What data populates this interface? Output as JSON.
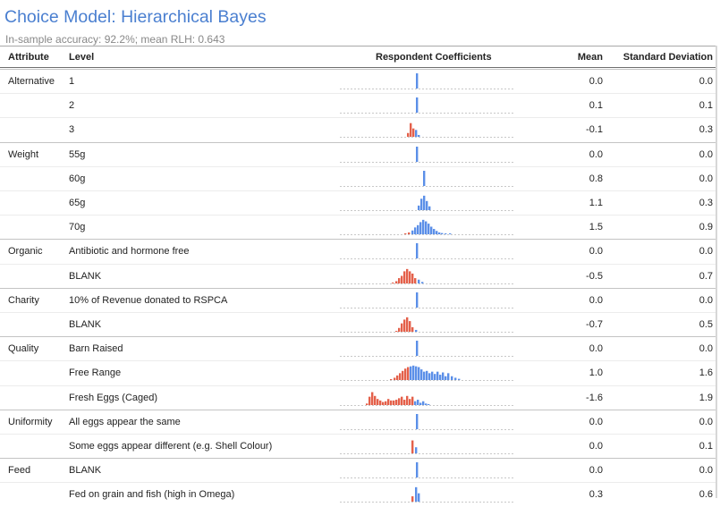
{
  "title": "Choice Model: Hierarchical Bayes",
  "subtitle": "In-sample accuracy: 92.2%; mean RLH: 0.643",
  "columns": {
    "attribute": "Attribute",
    "level": "Level",
    "coefficients": "Respondent Coefficients",
    "mean": "Mean",
    "sd": "Standard Deviation"
  },
  "colors": {
    "positive": "#5b8fe8",
    "negative": "#e4604a",
    "title": "#4a7fd0"
  },
  "chart_data": {
    "type": "table",
    "rows": [
      {
        "attribute": "Alternative",
        "level": "1",
        "mean": "0.0",
        "sd": "0.0"
      },
      {
        "attribute": "",
        "level": "2",
        "mean": "0.1",
        "sd": "0.1"
      },
      {
        "attribute": "",
        "level": "3",
        "mean": "-0.1",
        "sd": "0.3"
      },
      {
        "attribute": "Weight",
        "level": "55g",
        "mean": "0.0",
        "sd": "0.0"
      },
      {
        "attribute": "",
        "level": "60g",
        "mean": "0.8",
        "sd": "0.0"
      },
      {
        "attribute": "",
        "level": "65g",
        "mean": "1.1",
        "sd": "0.3"
      },
      {
        "attribute": "",
        "level": "70g",
        "mean": "1.5",
        "sd": "0.9"
      },
      {
        "attribute": "Organic",
        "level": "Antibiotic and hormone free",
        "mean": "0.0",
        "sd": "0.0"
      },
      {
        "attribute": "",
        "level": "BLANK",
        "mean": "-0.5",
        "sd": "0.7"
      },
      {
        "attribute": "Charity",
        "level": "10% of Revenue donated to RSPCA",
        "mean": "0.0",
        "sd": "0.0"
      },
      {
        "attribute": "",
        "level": "BLANK",
        "mean": "-0.7",
        "sd": "0.5"
      },
      {
        "attribute": "Quality",
        "level": "Barn Raised",
        "mean": "0.0",
        "sd": "0.0"
      },
      {
        "attribute": "",
        "level": "Free Range",
        "mean": "1.0",
        "sd": "1.6"
      },
      {
        "attribute": "",
        "level": "Fresh Eggs (Caged)",
        "mean": "-1.6",
        "sd": "1.9"
      },
      {
        "attribute": "Uniformity",
        "level": "All eggs appear the same",
        "mean": "0.0",
        "sd": "0.0"
      },
      {
        "attribute": "",
        "level": "Some eggs appear different (e.g. Shell Colour)",
        "mean": "0.0",
        "sd": "0.1"
      },
      {
        "attribute": "Feed",
        "level": "BLANK",
        "mean": "0.0",
        "sd": "0.0"
      },
      {
        "attribute": "",
        "level": "Fed on grain and fish (high in Omega)",
        "mean": "0.3",
        "sd": "0.6"
      }
    ],
    "histograms": [
      {
        "neg": [],
        "pos": [
          [
            85,
            1.0
          ]
        ]
      },
      {
        "neg": [],
        "pos": [
          [
            85,
            1.0
          ]
        ]
      },
      {
        "neg": [
          [
            75,
            0.25
          ],
          [
            78,
            0.9
          ],
          [
            81,
            0.55
          ]
        ],
        "pos": [
          [
            84,
            0.45
          ],
          [
            87,
            0.12
          ]
        ]
      },
      {
        "neg": [],
        "pos": [
          [
            85,
            1.0
          ]
        ]
      },
      {
        "neg": [],
        "pos": [
          [
            93,
            1.0
          ]
        ]
      },
      {
        "neg": [],
        "pos": [
          [
            87,
            0.3
          ],
          [
            90,
            0.75
          ],
          [
            93,
            0.95
          ],
          [
            96,
            0.6
          ],
          [
            99,
            0.25
          ]
        ]
      },
      {
        "neg": [
          [
            72,
            0.06
          ],
          [
            76,
            0.12
          ]
        ],
        "pos": [
          [
            80,
            0.25
          ],
          [
            83,
            0.45
          ],
          [
            86,
            0.6
          ],
          [
            89,
            0.8
          ],
          [
            92,
            0.95
          ],
          [
            95,
            0.85
          ],
          [
            98,
            0.7
          ],
          [
            101,
            0.5
          ],
          [
            104,
            0.35
          ],
          [
            107,
            0.22
          ],
          [
            110,
            0.12
          ],
          [
            113,
            0.08
          ],
          [
            117,
            0.05
          ],
          [
            122,
            0.03
          ]
        ]
      },
      {
        "neg": [],
        "pos": [
          [
            85,
            1.0
          ]
        ]
      },
      {
        "neg": [
          [
            58,
            0.06
          ],
          [
            62,
            0.15
          ],
          [
            65,
            0.35
          ],
          [
            68,
            0.5
          ],
          [
            71,
            0.8
          ],
          [
            74,
            0.95
          ],
          [
            77,
            0.8
          ],
          [
            80,
            0.65
          ],
          [
            83,
            0.35
          ]
        ],
        "pos": [
          [
            87,
            0.25
          ],
          [
            91,
            0.1
          ]
        ]
      },
      {
        "neg": [],
        "pos": [
          [
            85,
            1.0
          ]
        ]
      },
      {
        "neg": [
          [
            62,
            0.05
          ],
          [
            65,
            0.25
          ],
          [
            68,
            0.55
          ],
          [
            71,
            0.8
          ],
          [
            74,
            0.95
          ],
          [
            77,
            0.7
          ],
          [
            80,
            0.3
          ]
        ],
        "pos": [
          [
            84,
            0.12
          ]
        ]
      },
      {
        "neg": [],
        "pos": [
          [
            85,
            1.0
          ]
        ]
      },
      {
        "neg": [
          [
            56,
            0.06
          ],
          [
            60,
            0.15
          ],
          [
            63,
            0.3
          ],
          [
            66,
            0.45
          ],
          [
            69,
            0.6
          ],
          [
            72,
            0.75
          ],
          [
            75,
            0.85
          ]
        ],
        "pos": [
          [
            78,
            0.9
          ],
          [
            81,
            0.95
          ],
          [
            84,
            0.9
          ],
          [
            87,
            0.85
          ],
          [
            90,
            0.7
          ],
          [
            93,
            0.55
          ],
          [
            96,
            0.6
          ],
          [
            99,
            0.45
          ],
          [
            102,
            0.55
          ],
          [
            105,
            0.4
          ],
          [
            108,
            0.55
          ],
          [
            111,
            0.35
          ],
          [
            114,
            0.5
          ],
          [
            117,
            0.25
          ],
          [
            120,
            0.45
          ],
          [
            124,
            0.25
          ],
          [
            128,
            0.15
          ],
          [
            132,
            0.08
          ]
        ]
      },
      {
        "neg": [
          [
            29,
            0.1
          ],
          [
            32,
            0.55
          ],
          [
            35,
            0.85
          ],
          [
            38,
            0.6
          ],
          [
            41,
            0.4
          ],
          [
            44,
            0.3
          ],
          [
            47,
            0.2
          ],
          [
            50,
            0.25
          ],
          [
            53,
            0.4
          ],
          [
            56,
            0.3
          ],
          [
            59,
            0.3
          ],
          [
            62,
            0.35
          ],
          [
            65,
            0.45
          ],
          [
            68,
            0.55
          ],
          [
            71,
            0.35
          ],
          [
            74,
            0.6
          ],
          [
            77,
            0.4
          ],
          [
            80,
            0.55
          ]
        ],
        "pos": [
          [
            83,
            0.25
          ],
          [
            86,
            0.35
          ],
          [
            89,
            0.15
          ],
          [
            92,
            0.25
          ],
          [
            95,
            0.1
          ],
          [
            98,
            0.05
          ]
        ]
      },
      {
        "neg": [],
        "pos": [
          [
            85,
            1.0
          ]
        ]
      },
      {
        "neg": [
          [
            80,
            0.85
          ]
        ],
        "pos": [
          [
            84,
            0.4
          ]
        ]
      },
      {
        "neg": [],
        "pos": [
          [
            85,
            1.0
          ]
        ]
      },
      {
        "neg": [
          [
            80,
            0.35
          ]
        ],
        "pos": [
          [
            84,
            0.95
          ],
          [
            87,
            0.55
          ]
        ]
      }
    ]
  }
}
